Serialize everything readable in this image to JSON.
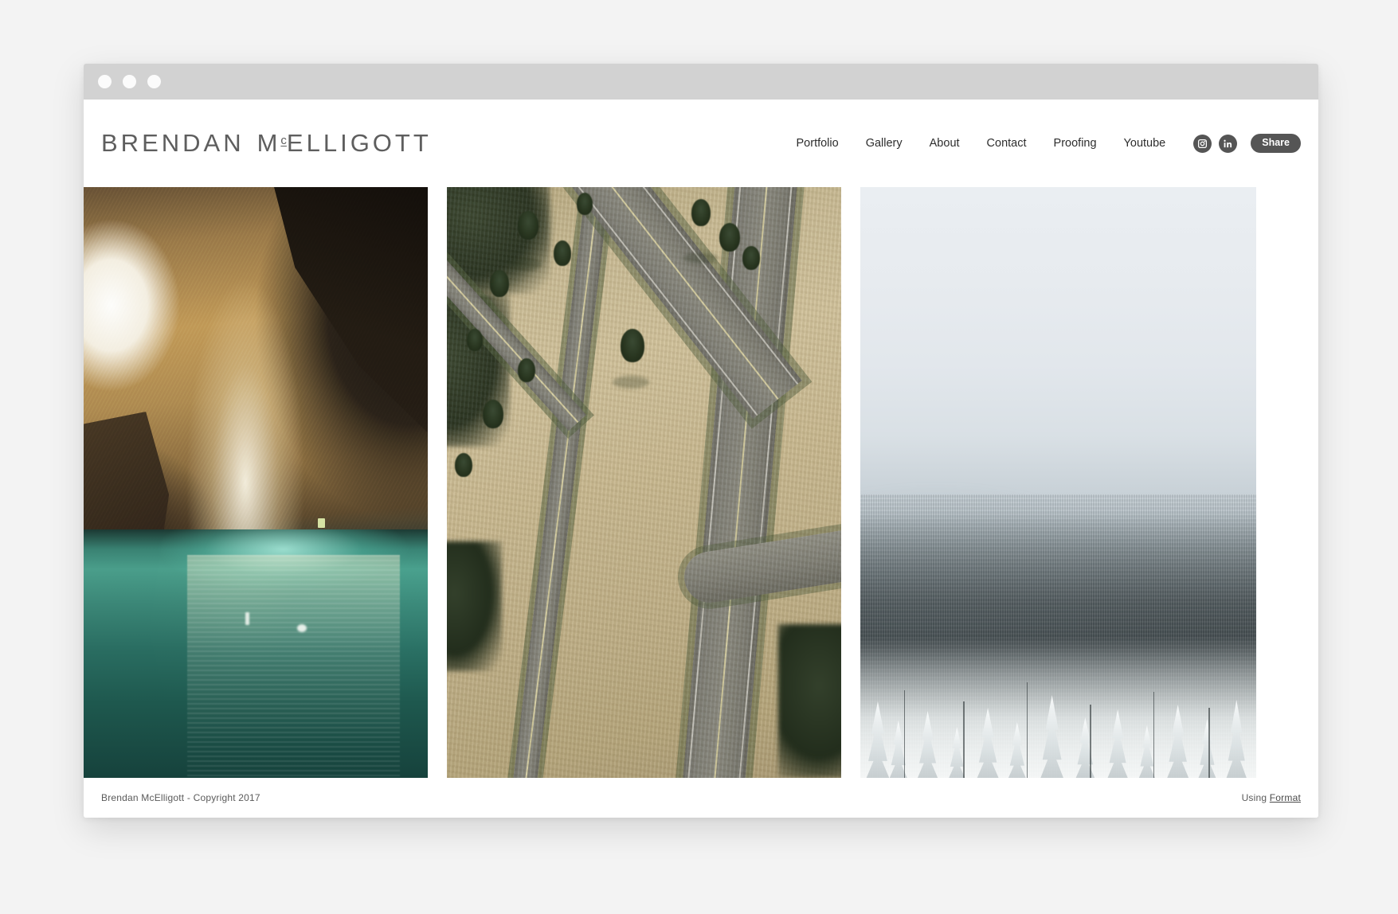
{
  "window": {
    "traffic_lights": [
      "close",
      "minimize",
      "maximize"
    ]
  },
  "site": {
    "logo": {
      "first_word": "BRENDAN",
      "mc_prefix": "M",
      "mc_superscript": "c",
      "mc_rest": "ELLIGOTT",
      "full_text": "BRENDAN MCELLIGOTT"
    },
    "nav": {
      "items": [
        {
          "label": "Portfolio"
        },
        {
          "label": "Gallery"
        },
        {
          "label": "About"
        },
        {
          "label": "Contact"
        },
        {
          "label": "Proofing"
        },
        {
          "label": "Youtube"
        }
      ]
    },
    "social": [
      {
        "name": "instagram-icon",
        "label": "Instagram"
      },
      {
        "name": "linkedin-icon",
        "label": "in"
      }
    ],
    "share_button": {
      "label": "Share",
      "background": "#555555",
      "text_color": "#ffffff"
    },
    "gallery": {
      "items": [
        {
          "alt": "Cave interior with golden limestone walls and turquoise underground pool",
          "dominant_colors": [
            "#c29b59",
            "#3f8f7e",
            "#2a2118"
          ]
        },
        {
          "alt": "Aerial view of two curving highways through dry tan grassland with evergreen trees",
          "dominant_colors": [
            "#cfc09a",
            "#85857c",
            "#28351f"
          ]
        },
        {
          "alt": "Misty foggy mountain ridge above a frosted snow-covered forest",
          "dominant_colors": [
            "#eaeef2",
            "#5a6265",
            "#f6f8f8"
          ]
        }
      ]
    },
    "footer": {
      "copyright": "Brendan McElligott - Copyright 2017",
      "using_prefix": "Using ",
      "platform": "Format"
    }
  },
  "theme": {
    "page_background": "#f3f3f3",
    "titlebar": "#d2d2d2",
    "content_background": "#ffffff",
    "nav_text": "#2d2d2d",
    "logo_text": "#5e5e5e",
    "footer_text": "#5a5a5a",
    "accent_dark": "#555555"
  }
}
